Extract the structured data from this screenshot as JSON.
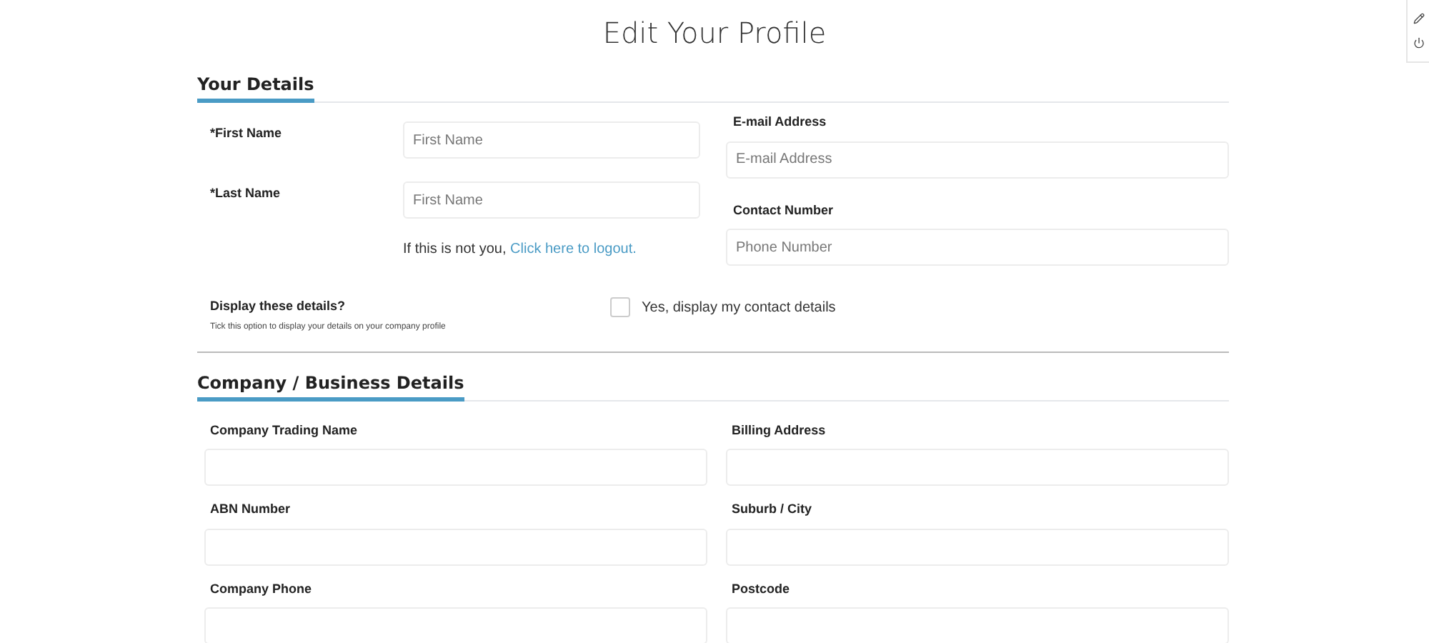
{
  "title": "Edit Your Profile",
  "your_details": {
    "heading": "Your Details",
    "name_fields": [
      {
        "label": "*First Name",
        "placeholder": "First Name"
      },
      {
        "label": "*Last Name",
        "placeholder": "First Name"
      }
    ],
    "logout_note": {
      "text": "If this is not you,",
      "link": "Click here to logout."
    },
    "contact_fields": [
      {
        "label": "E-mail Address",
        "placeholder": "E-mail Address"
      },
      {
        "label": "Contact Number",
        "placeholder": "Phone Number"
      }
    ],
    "display": {
      "label": "Display these details?",
      "hint": "Tick this option to display your details on your company profile",
      "checkbox_label": "Yes, display my contact details",
      "checked": false
    }
  },
  "company_details": {
    "heading": "Company / Business Details",
    "fields": [
      {
        "label": "Company Trading Name"
      },
      {
        "label": "Billing Address"
      },
      {
        "label": "ABN Number"
      },
      {
        "label": "Suburb / City"
      },
      {
        "label": "Company Phone"
      },
      {
        "label": "Postcode"
      }
    ]
  }
}
